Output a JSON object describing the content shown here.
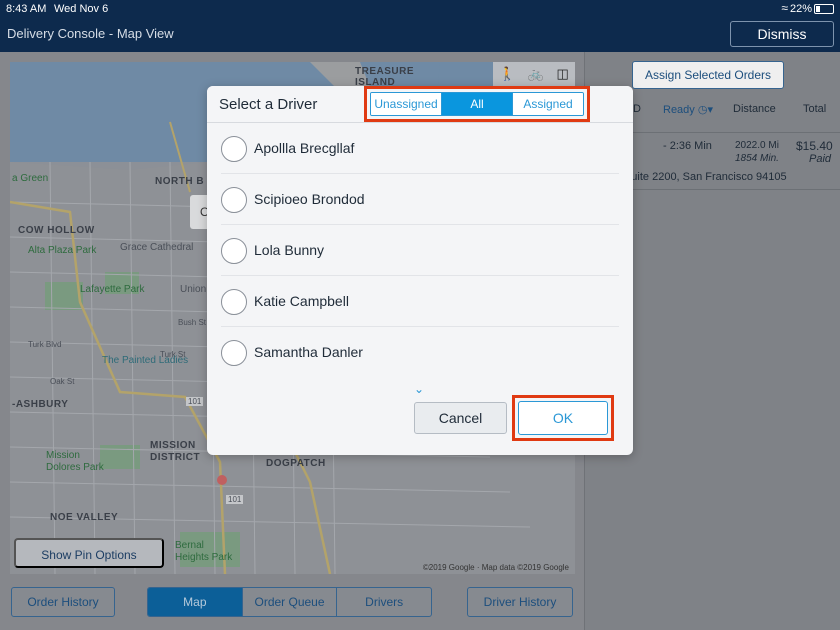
{
  "status_bar": {
    "time": "8:43 AM",
    "date": "Wed Nov 6",
    "battery": "22%"
  },
  "header": {
    "title": "Delivery Console - Map View",
    "dismiss_label": "Dismiss"
  },
  "map": {
    "labels": {
      "treasure_island": "TREASURE\nISLAND",
      "north_beach": "NORTH B",
      "green": "a Green",
      "cow_hollow": "COW HOLLOW",
      "grace_cathedral": "Grace Cathedral",
      "alta_plaza": "Alta Plaza Park",
      "lafayette": "Lafayette Park",
      "union": "Union",
      "painted_ladies": "The Painted Ladies",
      "ashbury": "-ASHBURY",
      "mission_district": "MISSION\nDISTRICT",
      "mission_dolores": "Mission\nDolores Park",
      "dogpatch": "DOGPATCH",
      "noe_valley": "NOE VALLEY",
      "bernal": "Bernal\nHeights Park",
      "hwy_101a": "101",
      "hwy_101b": "101",
      "turk": "Turk Blvd",
      "oak": "Oak St",
      "bush": "Bush St",
      "turk2": "Turk St"
    },
    "order_chip": "Ord",
    "copyright": "©2019 Google · Map data ©2019 Google",
    "transport_icons": [
      "walk-icon",
      "bike-icon",
      "car-icon"
    ]
  },
  "show_pin_options": "Show Pin Options",
  "bottom_nav": {
    "order_history": "Order History",
    "tabs": [
      "Map",
      "Order Queue",
      "Drivers"
    ],
    "driver_history": "Driver History"
  },
  "right_panel": {
    "assign_button": "Assign Selected Orders",
    "columns": {
      "id_partial": "D",
      "ready": "Ready",
      "distance": "Distance",
      "total": "Total"
    },
    "row": {
      "ready": "- 2:36 Min",
      "distance": "2022.0 Mi",
      "distance_sub": "1854 Min.",
      "total": "$15.40",
      "payment": "Paid",
      "address": "arket St Suite 2200, San Francisco 94105"
    }
  },
  "modal": {
    "title": "Select a Driver",
    "filters": [
      "Unassigned",
      "All",
      "Assigned"
    ],
    "active_filter": "All",
    "drivers": [
      "Apollla Brecgllaf",
      "Scipioeo Brondod",
      "Lola Bunny",
      "Katie Campbell",
      "Samantha Danler"
    ],
    "cancel_label": "Cancel",
    "ok_label": "OK",
    "highlight_color": "#e03a12"
  }
}
